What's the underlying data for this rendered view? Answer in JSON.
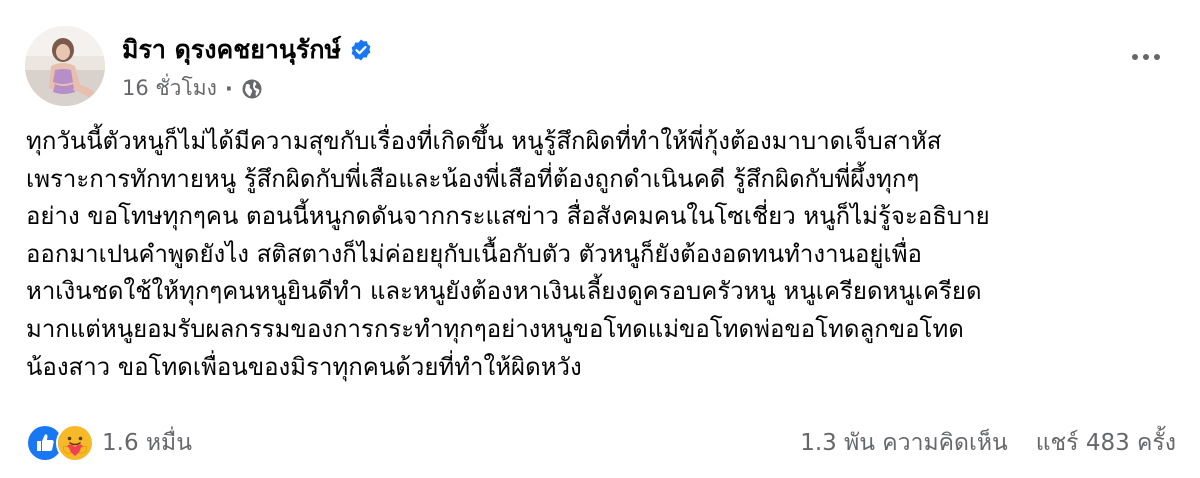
{
  "post": {
    "author": "มิรา ดุรงคชยานุรักษ์",
    "timestamp": "16 ชั่วโมง",
    "separator": "·",
    "privacy_icon": "globe-icon",
    "verified_icon": "verified-badge-icon",
    "more_icon": "more-options-icon",
    "text_lines": [
      "ทุกวันนี้ตัวหนูก็ไม่ได้มีความสุขกับเรื่องที่เกิดขึ้น หนูรู้สึกผิดที่ทำให้พี่กุ้งต้องมาบาดเจ็บสาหัส",
      "เพราะการทักทายหนู รู้สึกผิดกับพี่เสือและน้องพี่เสือที่ต้องถูกดำเนินคดี รู้สึกผิดกับพี่ผึ้งทุกๆ",
      "อย่าง ขอโทษทุกๆคน ตอนนี้หนูกดดันจากกระแสข่าว สื่อสังคมคนในโซเชี่ยว หนูก็ไม่รู้จะอธิบาย",
      "ออกมาเปนคำพูดยังไง สติสตางก็ไม่ค่อยยุกับเนื้อกับตัว ตัวหนูก็ยังต้องอดทนทำงานอยู่เพื่อ",
      "หาเงินชดใช้ให้ทุกๆคนหนูยินดีทำ และหนูยังต้องหาเงินเลี้ยงดูครอบครัวหนู หนูเครียดหนูเครียด",
      "มากแต่หนูยอมรับผลกรรมของการกระทำทุกๆอย่างหนูขอโทดแม่ขอโทดพ่อขอโทดลูกขอโทด",
      "น้องสาว ขอโทดเพื่อนของมิราทุกคนด้วยที่ทำให้ผิดหวัง"
    ]
  },
  "footer": {
    "reactions_count": "1.6 หมื่น",
    "reaction_icons": [
      "like-icon",
      "care-icon"
    ],
    "comments": "1.3 พัน ความคิดเห็น",
    "shares": "แชร์ 483 ครั้ง"
  },
  "colors": {
    "text_primary": "#050505",
    "text_secondary": "#65676b",
    "verified_blue": "#1877f2",
    "like_blue": "#1877f2",
    "care_yellow": "#f7b928",
    "care_heart": "#f33e58"
  }
}
